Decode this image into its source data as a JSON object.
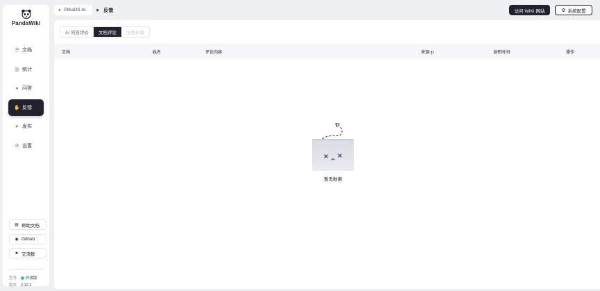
{
  "sidebar": {
    "logo_text": "PandaWiki",
    "items": [
      {
        "label": "文档",
        "icon": "document-icon",
        "glyph": "☰"
      },
      {
        "label": "统计",
        "icon": "bar-chart-icon",
        "glyph": "▥"
      },
      {
        "label": "问答",
        "icon": "chat-icon",
        "glyph": "●"
      },
      {
        "label": "反馈",
        "icon": "hand-icon",
        "glyph": "✋"
      },
      {
        "label": "发布",
        "icon": "send-icon",
        "glyph": "➤"
      },
      {
        "label": "设置",
        "icon": "gear-icon",
        "glyph": "⚙"
      }
    ],
    "active_index": 3,
    "links": [
      {
        "label": "帮助文档",
        "icon": "doc-icon",
        "glyph": "▤"
      },
      {
        "label": "Github",
        "icon": "github-icon",
        "glyph": "◉"
      },
      {
        "label": "交流群",
        "icon": "group-icon",
        "glyph": "♣"
      }
    ],
    "meta": {
      "edition_label": "型号",
      "edition_value": "开源版",
      "version_label": "版本",
      "version_value": "2.12.2"
    }
  },
  "header": {
    "project": "PiKaOS AI",
    "current": "反馈",
    "wiki_button": "访问 WIKI 网站",
    "settings_button": "系统配置"
  },
  "tabs": [
    {
      "label": "AI 问答评价",
      "state": "normal"
    },
    {
      "label": "文档评论",
      "state": "active"
    },
    {
      "label": "文档纠错",
      "state": "disabled"
    }
  ],
  "table": {
    "columns": [
      "文档",
      "姓名",
      "评论内容",
      "来源 ip",
      "发布时间",
      "操作"
    ]
  },
  "empty": {
    "text": "暂无数据",
    "icon": "empty-box-icon"
  },
  "colors": {
    "primary": "#21222d",
    "background": "#eef0f2",
    "table_header": "#f5f6f8",
    "online_dot": "#35c78a"
  }
}
